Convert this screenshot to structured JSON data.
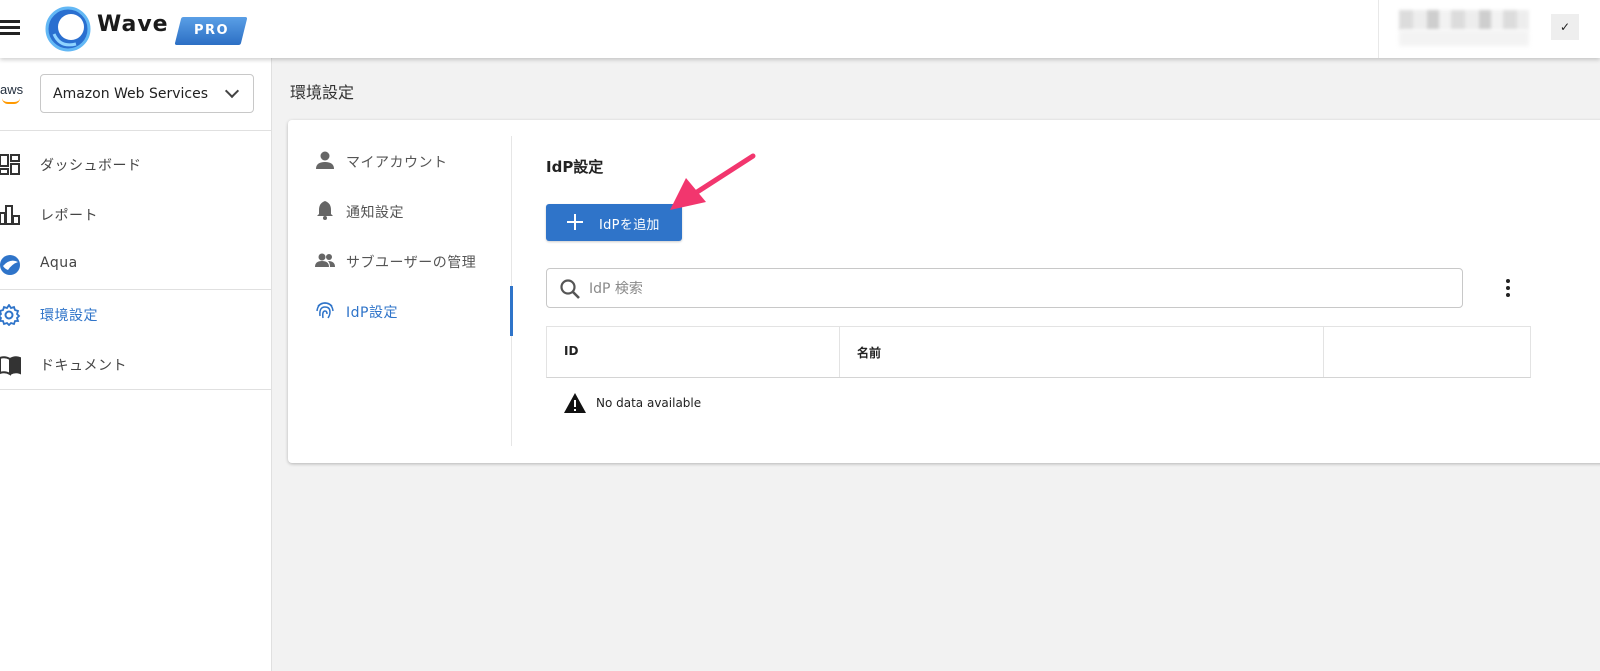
{
  "header": {
    "app_name": "Wave",
    "badge": "PRO",
    "user_checkmark": "✓"
  },
  "sidebar": {
    "cloud_logo": "aws",
    "account_selector": "Amazon Web Services",
    "items": [
      {
        "label": "ダッシュボード",
        "icon": "dashboard-icon"
      },
      {
        "label": "レポート",
        "icon": "report-icon"
      },
      {
        "label": "Aqua",
        "icon": "aqua-icon"
      },
      {
        "label": "環境設定",
        "icon": "gear-icon",
        "active": true
      },
      {
        "label": "ドキュメント",
        "icon": "book-icon"
      }
    ]
  },
  "main": {
    "page_title": "環境設定",
    "tabs": [
      {
        "label": "マイアカウント",
        "icon": "person-icon"
      },
      {
        "label": "通知設定",
        "icon": "bell-icon"
      },
      {
        "label": "サブユーザーの管理",
        "icon": "people-icon"
      },
      {
        "label": "IdP設定",
        "icon": "fingerprint-icon",
        "active": true
      }
    ],
    "section_title": "IdP設定",
    "add_button": "IdPを追加",
    "search_placeholder": "IdP 検索",
    "table": {
      "columns": [
        "ID",
        "名前",
        ""
      ],
      "empty_text": "No data available"
    }
  },
  "colors": {
    "accent": "#2f74c9",
    "annotation_arrow": "#f2366e"
  }
}
